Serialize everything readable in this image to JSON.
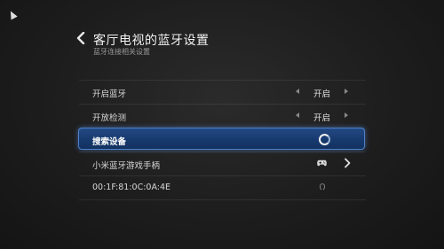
{
  "header": {
    "title": "客厅电视的蓝牙设置",
    "subtitle": "蓝牙连接相关设置"
  },
  "settings": {
    "bluetooth": {
      "label": "开启蓝牙",
      "value": "开启"
    },
    "discoverable": {
      "label": "开放检测",
      "value": "开启"
    },
    "search": {
      "label": "搜索设备"
    }
  },
  "devices": [
    {
      "name": "小米蓝牙游戏手柄",
      "icon": "gamepad-icon"
    },
    {
      "name": "00:1F:81:0C:0A:4E",
      "icon": "bluetooth-icon"
    }
  ],
  "colors": {
    "selection": "#1b3f77",
    "selection_border": "#4f80c7"
  }
}
